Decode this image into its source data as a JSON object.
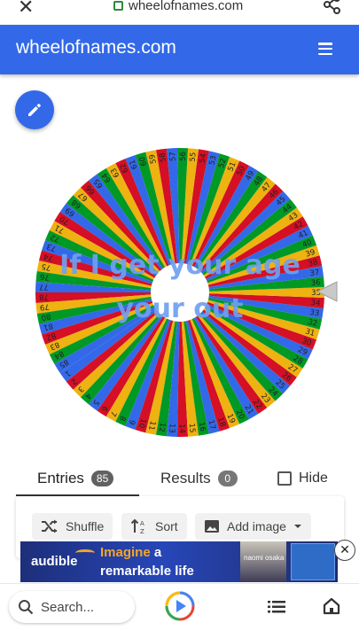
{
  "browser": {
    "url": "wheelofnames.com",
    "close_glyph": "✕"
  },
  "header": {
    "title": "wheelofnames.com"
  },
  "wheel": {
    "entry_min": 1,
    "entry_max": 85,
    "overlay_text_line1": "If I get your age",
    "overlay_text_line2": "your out",
    "segment_colors": [
      "#3369e8",
      "#d50f25",
      "#eeb211",
      "#009925"
    ],
    "label_color": "#222222",
    "overlay_color": "#6fa0f0"
  },
  "tabs": {
    "entries_label": "Entries",
    "entries_count": "85",
    "results_label": "Results",
    "results_count": "0",
    "hide_label": "Hide"
  },
  "toolbar": {
    "shuffle_label": "Shuffle",
    "sort_label": "Sort",
    "add_image_label": "Add image"
  },
  "ad": {
    "brand": "audible",
    "line1_highlight": "Imagine",
    "line1_rest": " a",
    "line2": "remarkable life",
    "person_name": "naomi osaka"
  },
  "bottom_nav": {
    "search_placeholder": "Search..."
  }
}
